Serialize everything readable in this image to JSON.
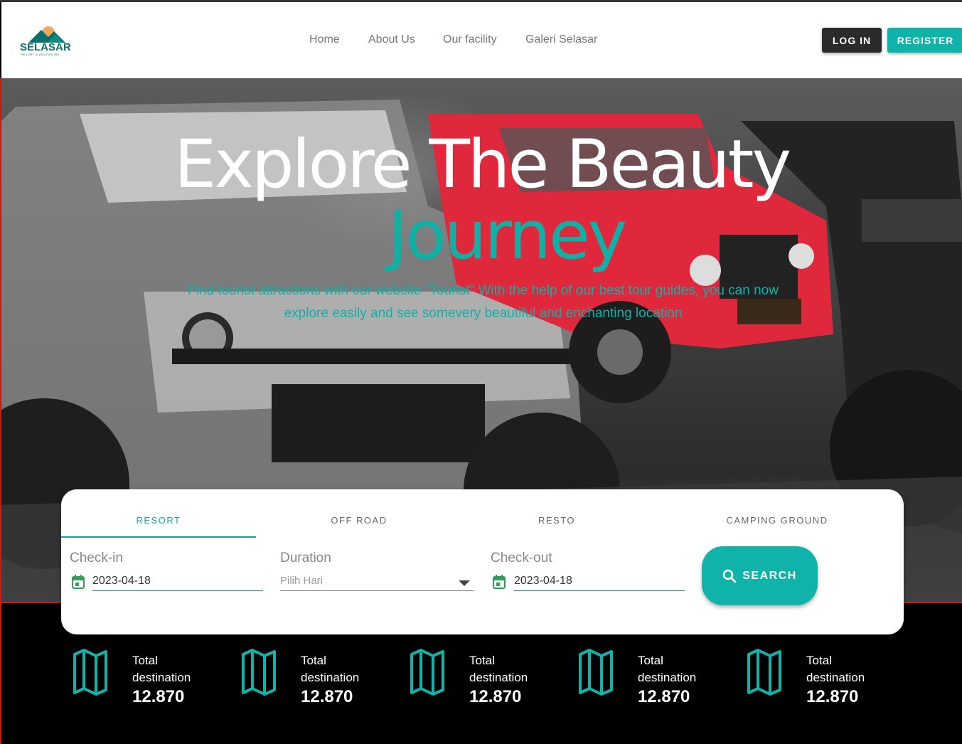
{
  "logo": {
    "name": "SELASAR",
    "tagline": "RESORT & ADVENTURE"
  },
  "nav": {
    "items": [
      "Home",
      "About Us",
      "Our facility",
      "Galeri Selasar"
    ]
  },
  "auth": {
    "login": "LOG IN",
    "register": "REGISTER"
  },
  "hero": {
    "title": "Explore The Beauty",
    "accent": "Journey",
    "description": "Find tourist attractions with our website \"Tourist\" With the help of our best tour guides, you can now explore easily and see somevery beautiful and enchanting location"
  },
  "search": {
    "tabs": [
      "RESORT",
      "OFF ROAD",
      "RESTO",
      "CAMPING GROUND"
    ],
    "active_tab": "RESORT",
    "checkin": {
      "label": "Check-in",
      "value": "2023-04-18"
    },
    "duration": {
      "label": "Duration",
      "placeholder": "Pilih Hari"
    },
    "checkout": {
      "label": "Check-out",
      "value": "2023-04-18"
    },
    "button": "SEARCH"
  },
  "stats": [
    {
      "label1": "Total",
      "label2": "destination",
      "value": "12.870",
      "icon": "map-icon"
    },
    {
      "label1": "Total",
      "label2": "destination",
      "value": "12.870",
      "icon": "map-icon"
    },
    {
      "label1": "Total",
      "label2": "destination",
      "value": "12.870",
      "icon": "map-icon"
    },
    {
      "label1": "Total",
      "label2": "destination",
      "value": "12.870",
      "icon": "map-icon"
    },
    {
      "label1": "Total",
      "label2": "destination",
      "value": "12.870",
      "icon": "map-icon"
    }
  ],
  "colors": {
    "accent": "#10b3aa",
    "dark_button": "#2b2b2b",
    "calendar_icon": "#2f9e5a"
  }
}
